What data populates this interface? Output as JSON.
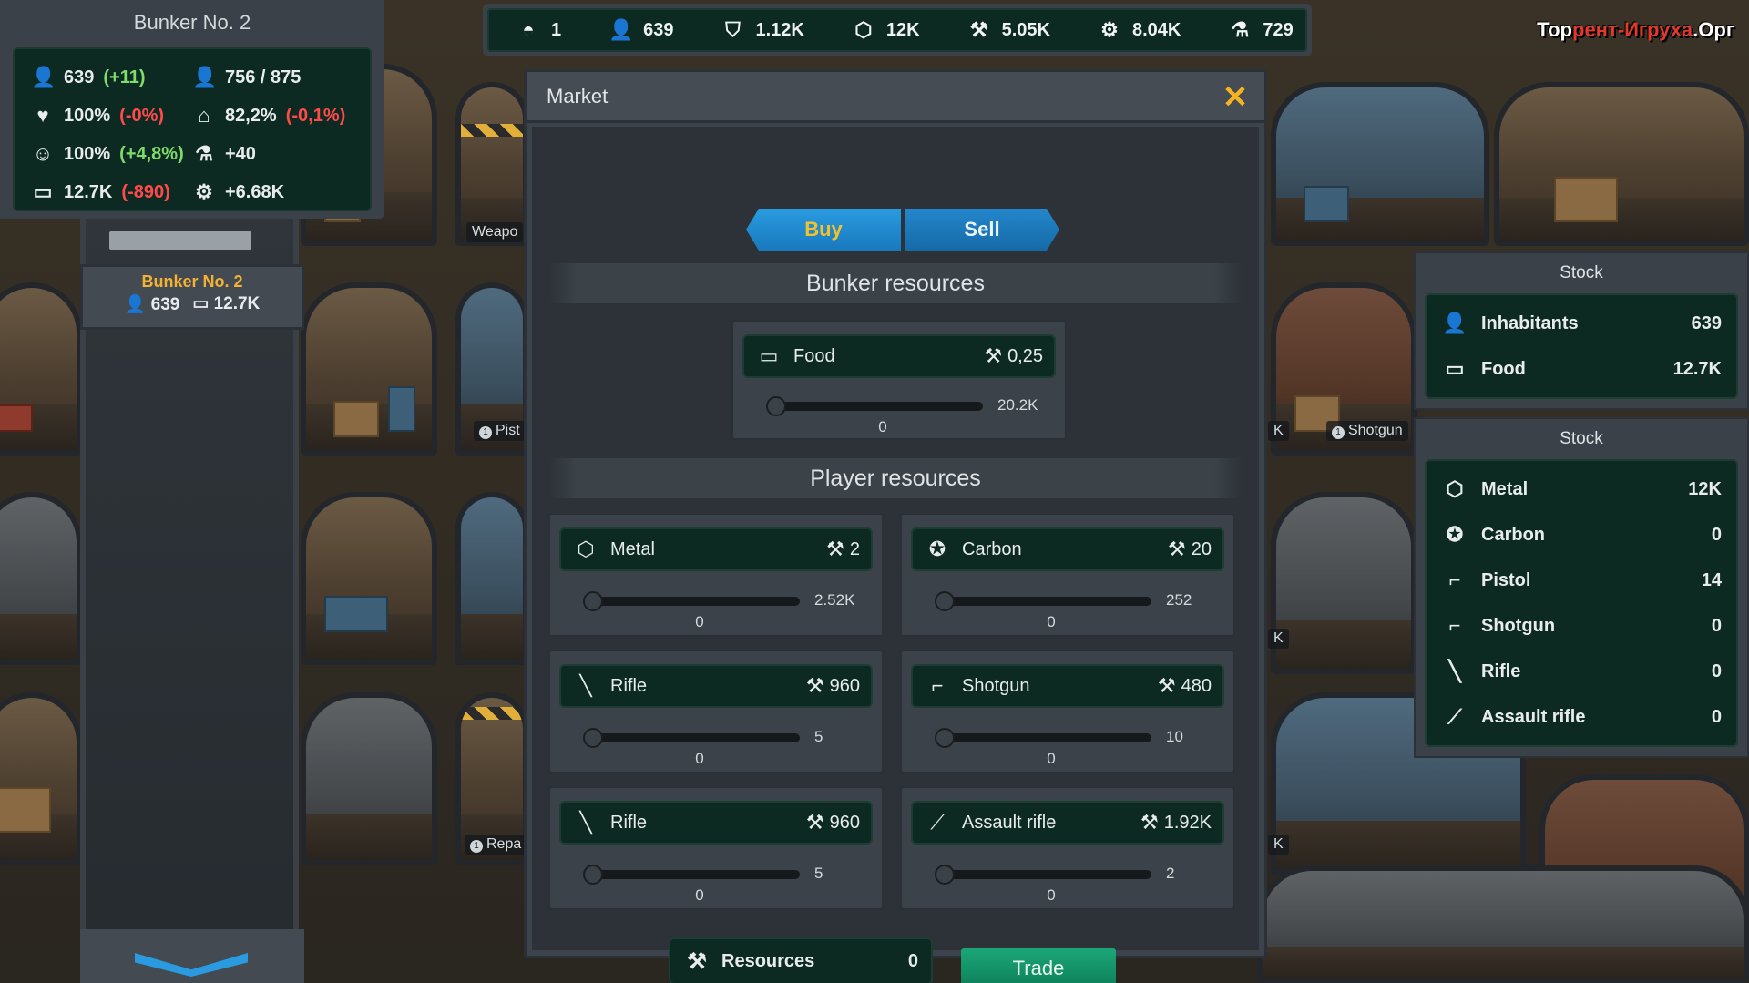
{
  "watermark": {
    "pre": "Тор",
    "mid": "рент-Игруха",
    "post": ".Орг"
  },
  "topbar": {
    "stats": [
      {
        "icon": "bunker-icon",
        "glyph": "◓",
        "value": "1"
      },
      {
        "icon": "person-icon",
        "glyph": "👤",
        "value": "639"
      },
      {
        "icon": "rank-icon",
        "glyph": "⛉",
        "value": "1.12K"
      },
      {
        "icon": "metal-icon",
        "glyph": "⬡",
        "value": "12K"
      },
      {
        "icon": "tools-icon",
        "glyph": "⚒",
        "value": "5.05K"
      },
      {
        "icon": "gear-icon",
        "glyph": "⚙",
        "value": "8.04K"
      },
      {
        "icon": "flask-icon",
        "glyph": "⚗",
        "value": "729"
      }
    ]
  },
  "bunker": {
    "title": "Bunker No. 2",
    "stats": {
      "population": {
        "value": "639",
        "delta": "(+11)"
      },
      "capacity": {
        "value": "756 / 875"
      },
      "health": {
        "value": "100%",
        "delta": "(-0%)"
      },
      "defense": {
        "value": "82,2%",
        "delta": "(-0,1%)"
      },
      "happiness": {
        "value": "100%",
        "delta": "(+4,8%)"
      },
      "research": {
        "value": "+40"
      },
      "food": {
        "value": "12.7K",
        "delta": "(-890)"
      },
      "production": {
        "value": "+6.68K"
      }
    },
    "tab": {
      "title": "Bunker No. 2",
      "people": "639",
      "food": "12.7K"
    }
  },
  "rooms": {
    "labels": [
      "Weapo",
      "Pist",
      "Repa",
      "Shotgun",
      "K",
      "K",
      "K"
    ]
  },
  "market": {
    "title": "Market",
    "tabs": {
      "buy": "Buy",
      "sell": "Sell"
    },
    "bunker_section": "Bunker resources",
    "player_section": "Player resources",
    "bunker_resources": [
      {
        "name": "Food",
        "price": "0,25",
        "max": "20.2K",
        "value": "0"
      }
    ],
    "player_resources": [
      {
        "name": "Metal",
        "price": "2",
        "max": "2.52K",
        "value": "0"
      },
      {
        "name": "Carbon",
        "price": "20",
        "max": "252",
        "value": "0"
      },
      {
        "name": "Rifle",
        "price": "960",
        "max": "5",
        "value": "0"
      },
      {
        "name": "Shotgun",
        "price": "480",
        "max": "10",
        "value": "0"
      },
      {
        "name": "Rifle",
        "price": "960",
        "max": "5",
        "value": "0"
      },
      {
        "name": "Assault rifle",
        "price": "1.92K",
        "max": "2",
        "value": "0"
      }
    ],
    "total": {
      "label": "Resources",
      "value": "0"
    },
    "trade": "Trade"
  },
  "stock_top": {
    "title": "Stock",
    "items": [
      {
        "label": "Inhabitants",
        "value": "639"
      },
      {
        "label": "Food",
        "value": "12.7K"
      }
    ]
  },
  "stock_bottom": {
    "title": "Stock",
    "items": [
      {
        "label": "Metal",
        "value": "12K"
      },
      {
        "label": "Carbon",
        "value": "0"
      },
      {
        "label": "Pistol",
        "value": "14"
      },
      {
        "label": "Shotgun",
        "value": "0"
      },
      {
        "label": "Rifle",
        "value": "0"
      },
      {
        "label": "Assault rifle",
        "value": "0"
      }
    ]
  },
  "colors": {
    "accent_gold": "#f3b233",
    "panel_green": "#0d2a22",
    "tab_blue": "#2a9be0",
    "trade_green": "#1ba678",
    "positive": "#7fdc6b",
    "negative": "#ff4a4a"
  }
}
